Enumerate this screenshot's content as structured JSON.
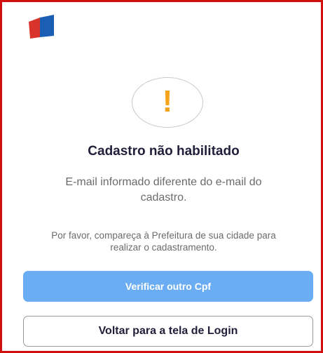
{
  "app": {
    "logo_icon": "app-logo-icon",
    "logo_colors": [
      "#d9342b",
      "#1b5fb4"
    ]
  },
  "alert": {
    "icon": "exclamation-icon",
    "icon_color": "#f5a31a",
    "glyph": "!"
  },
  "dialog": {
    "title": "Cadastro não habilitado",
    "message": "E-mail informado diferente do e-mail do cadastro.",
    "note": "Por favor, compareça à Prefeitura de sua cidade para realizar o cadastramento."
  },
  "actions": {
    "primary_label": "Verificar outro Cpf",
    "primary_color": "#6aadf3",
    "secondary_label": "Voltar para a tela de Login"
  }
}
